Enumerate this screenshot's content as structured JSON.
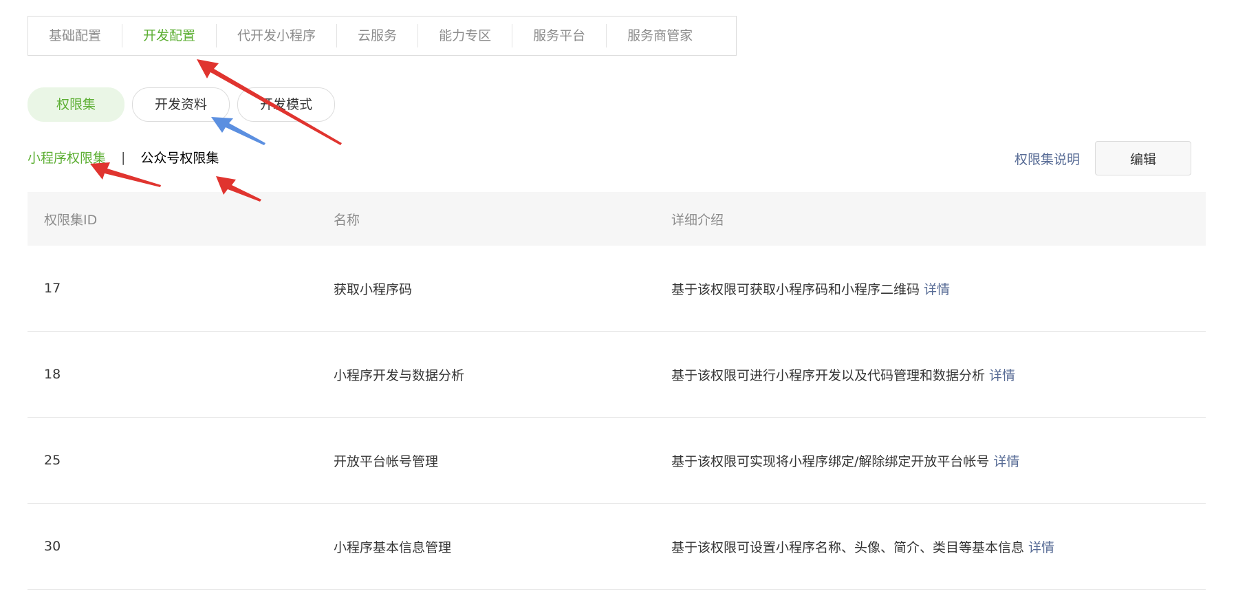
{
  "top_tabs": [
    {
      "label": "基础配置",
      "active": false
    },
    {
      "label": "开发配置",
      "active": true
    },
    {
      "label": "代开发小程序",
      "active": false
    },
    {
      "label": "云服务",
      "active": false
    },
    {
      "label": "能力专区",
      "active": false
    },
    {
      "label": "服务平台",
      "active": false
    },
    {
      "label": "服务商管家",
      "active": false
    }
  ],
  "pill_tabs": [
    {
      "label": "权限集",
      "active": true
    },
    {
      "label": "开发资料",
      "active": false
    },
    {
      "label": "开发模式",
      "active": false
    }
  ],
  "sub_tabs": {
    "miniprogram": "小程序权限集",
    "separator": "|",
    "official": "公众号权限集"
  },
  "actions": {
    "help_link": "权限集说明",
    "edit_button": "编辑"
  },
  "table": {
    "headers": [
      "权限集ID",
      "名称",
      "详细介绍"
    ],
    "rows": [
      {
        "id": "17",
        "name": "获取小程序码",
        "desc": "基于该权限可获取小程序码和小程序二维码",
        "link": "详情"
      },
      {
        "id": "18",
        "name": "小程序开发与数据分析",
        "desc": "基于该权限可进行小程序开发以及代码管理和数据分析",
        "link": "详情"
      },
      {
        "id": "25",
        "name": "开放平台帐号管理",
        "desc": "基于该权限可实现将小程序绑定/解除绑定开放平台帐号",
        "link": "详情"
      },
      {
        "id": "30",
        "name": "小程序基本信息管理",
        "desc": "基于该权限可设置小程序名称、头像、简介、类目等基本信息",
        "link": "详情"
      }
    ]
  },
  "colors": {
    "accent_green": "#5daf34",
    "link_blue": "#576b95",
    "arrow_red": "#e0342f",
    "arrow_blue": "#5b8fe0"
  }
}
